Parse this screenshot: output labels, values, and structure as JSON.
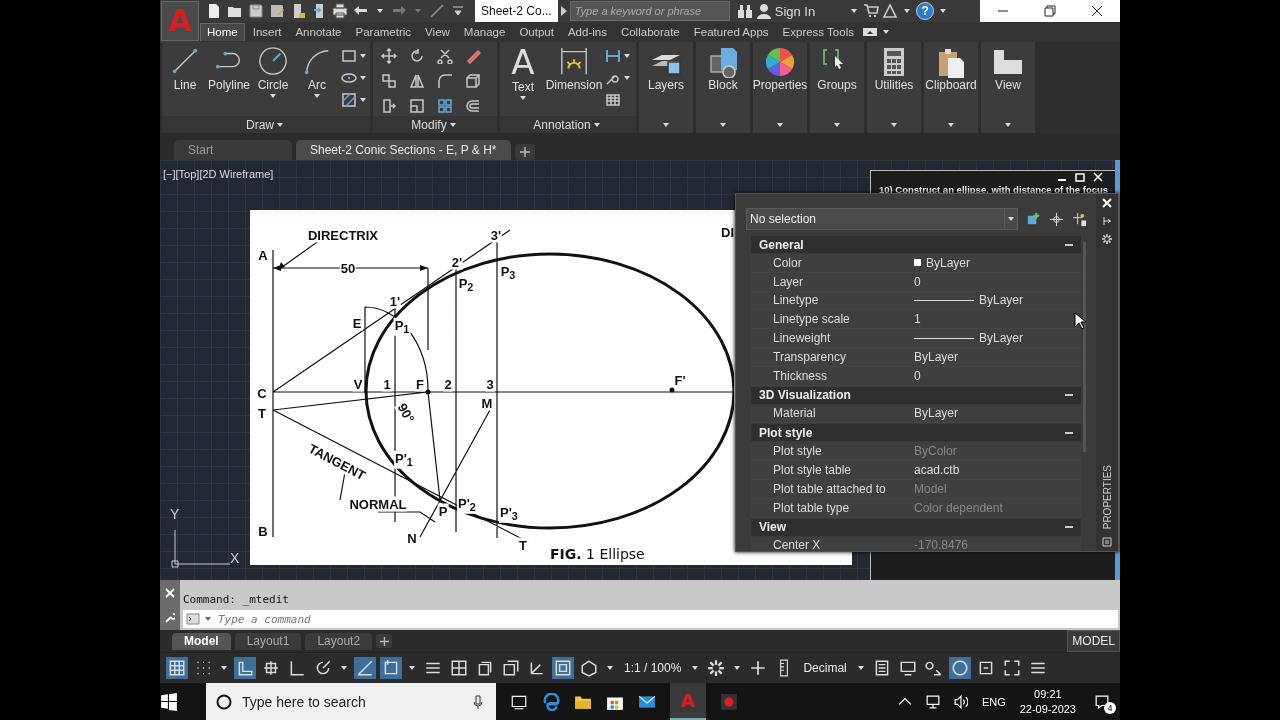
{
  "app_logo": "A",
  "title_bar": {
    "document_tab": "Sheet-2 Co...",
    "search": {
      "placeholder": "Type a keyword or phrase"
    },
    "sign_in": "Sign In",
    "help": "?"
  },
  "ribbon_tabs": [
    {
      "label": "Home",
      "selected": true
    },
    {
      "label": "Insert",
      "selected": false
    },
    {
      "label": "Annotate",
      "selected": false
    },
    {
      "label": "Parametric",
      "selected": false
    },
    {
      "label": "View",
      "selected": false
    },
    {
      "label": "Manage",
      "selected": false
    },
    {
      "label": "Output",
      "selected": false
    },
    {
      "label": "Add-ins",
      "selected": false
    },
    {
      "label": "Collaborate",
      "selected": false
    },
    {
      "label": "Featured Apps",
      "selected": false
    },
    {
      "label": "Express Tools",
      "selected": false
    }
  ],
  "ribbon": {
    "draw": {
      "title": "Draw",
      "tools": [
        "Line",
        "Polyline",
        "Circle",
        "Arc"
      ]
    },
    "modify": {
      "title": "Modify"
    },
    "annotation": {
      "title": "Annotation",
      "text_glyph": "A",
      "tools": [
        "Text",
        "Dimension"
      ]
    },
    "panels": [
      "Layers",
      "Block",
      "Properties",
      "Groups",
      "Utilities",
      "Clipboard",
      "View"
    ]
  },
  "file_tabs": [
    {
      "label": "Start",
      "selected": false
    },
    {
      "label": "Sheet-2 Conic Sections - E, P & H*",
      "selected": true
    }
  ],
  "viewport_label": "[−][Top][2D Wireframe]",
  "figure": {
    "labels": [
      "DIRECTRIX",
      "A",
      "50",
      "1'",
      "E",
      "P$_{1}$",
      "C",
      "T",
      "V",
      "1",
      "F",
      "2",
      "3",
      "F'",
      "2'",
      "3'",
      "P$_{2}$",
      "P$_{3}$",
      "90°",
      "M",
      "TANGENT",
      "P'$_{1}$",
      "NORMAL",
      "P",
      "P'$_{2}$",
      "P'$_{3}$",
      "N",
      "T",
      "B",
      "DI"
    ],
    "caption": "**FIG.** 1  Ellipse"
  },
  "ucs": {
    "y": "Y",
    "x": "X"
  },
  "text_window": {
    "text": "10) Construct an ellipse, with distance of the focus"
  },
  "properties_palette": {
    "selection": "No selection",
    "title": "PROPERTIES",
    "sections": [
      {
        "title": "General",
        "expanded": true,
        "rows": [
          {
            "label": "Color",
            "value": "ByLayer",
            "kind": "swatch",
            "disabled": false
          },
          {
            "label": "Layer",
            "value": "0",
            "kind": "text",
            "disabled": false
          },
          {
            "label": "Linetype",
            "value": "ByLayer",
            "kind": "line",
            "disabled": false
          },
          {
            "label": "Linetype scale",
            "value": "1",
            "kind": "text",
            "disabled": false
          },
          {
            "label": "Lineweight",
            "value": "ByLayer",
            "kind": "line",
            "disabled": false
          },
          {
            "label": "Transparency",
            "value": "ByLayer",
            "kind": "text",
            "disabled": false
          },
          {
            "label": "Thickness",
            "value": "0",
            "kind": "text",
            "disabled": false
          }
        ]
      },
      {
        "title": "3D Visualization",
        "expanded": true,
        "rows": [
          {
            "label": "Material",
            "value": "ByLayer",
            "kind": "text",
            "disabled": false
          }
        ]
      },
      {
        "title": "Plot style",
        "expanded": true,
        "rows": [
          {
            "label": "Plot style",
            "value": "ByColor",
            "kind": "text",
            "disabled": true
          },
          {
            "label": "Plot style table",
            "value": "acad.ctb",
            "kind": "text",
            "disabled": false
          },
          {
            "label": "Plot table attached to",
            "value": "Model",
            "kind": "text",
            "disabled": true
          },
          {
            "label": "Plot table type",
            "value": "Color dependent",
            "kind": "text",
            "disabled": true
          }
        ]
      },
      {
        "title": "View",
        "expanded": true,
        "rows": [
          {
            "label": "Center X",
            "value": "-170.8476",
            "kind": "text",
            "disabled": true
          }
        ]
      }
    ]
  },
  "command_line": {
    "history": "Command: _mtedit",
    "placeholder": "Type a command"
  },
  "layout_tabs": [
    {
      "label": "Model",
      "selected": true
    },
    {
      "label": "Layout1",
      "selected": false
    },
    {
      "label": "Layout2",
      "selected": false
    }
  ],
  "model_button": "MODEL",
  "status_bar": {
    "toggles_left": [
      {
        "on": true
      },
      {
        "on": false
      },
      {
        "on": true
      },
      {
        "on": false
      },
      {
        "on": false
      },
      {
        "on": false
      },
      {
        "on": true
      },
      {
        "on": true
      },
      {
        "on": false
      },
      {
        "on": false
      },
      {
        "on": false
      },
      {
        "on": false
      },
      {
        "on": false
      },
      {
        "on": true
      },
      {
        "on": false
      }
    ],
    "scale": "1:1 / 100%",
    "units": "Decimal",
    "toggles_right": [
      {
        "on": false
      },
      {
        "on": false
      },
      {
        "on": false
      },
      {
        "on": true
      },
      {
        "on": false
      },
      {
        "on": false
      }
    ]
  },
  "taskbar": {
    "search": {
      "placeholder": "Type here to search"
    },
    "autocad_glyph": "A",
    "language": "ENG",
    "time": "09:21",
    "date": "22-09-2023",
    "notifications": "4"
  }
}
